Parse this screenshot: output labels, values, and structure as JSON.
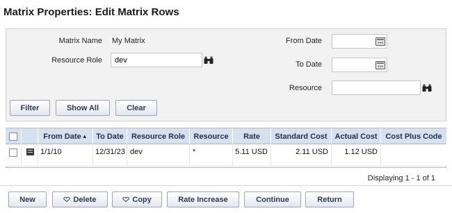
{
  "page": {
    "title": "Matrix Properties: Edit Matrix Rows"
  },
  "filter": {
    "matrix_name_label": "Matrix Name",
    "matrix_name_value": "My Matrix",
    "resource_role_label": "Resource Role",
    "resource_role_value": "dev",
    "from_date_label": "From Date",
    "from_date_value": "",
    "to_date_label": "To Date",
    "to_date_value": "",
    "resource_label": "Resource",
    "resource_value": "",
    "buttons": {
      "filter": "Filter",
      "show_all": "Show All",
      "clear": "Clear"
    }
  },
  "grid": {
    "columns": [
      "",
      "",
      "From Date",
      "To Date",
      "Resource Role",
      "Resource",
      "Rate",
      "Standard Cost",
      "Actual Cost",
      "Cost Plus Code"
    ],
    "sort_indicator": "▲",
    "rows": [
      {
        "from_date": "1/1/10",
        "to_date": "12/31/23",
        "resource_role": "dev",
        "resource": "*",
        "rate": "5.11 USD",
        "standard_cost": "2.11 USD",
        "actual_cost": "1.12 USD",
        "cost_plus_code": ""
      }
    ],
    "paging": "Displaying 1 - 1 of 1"
  },
  "actions": {
    "new": "New",
    "delete": "Delete",
    "copy": "Copy",
    "rate_increase": "Rate Increase",
    "continue": "Continue",
    "return": "Return"
  },
  "colors": {
    "header_bg": "#d6e1f0",
    "button_text": "#2a3a55",
    "panel_bg": "#f2f2f2"
  }
}
